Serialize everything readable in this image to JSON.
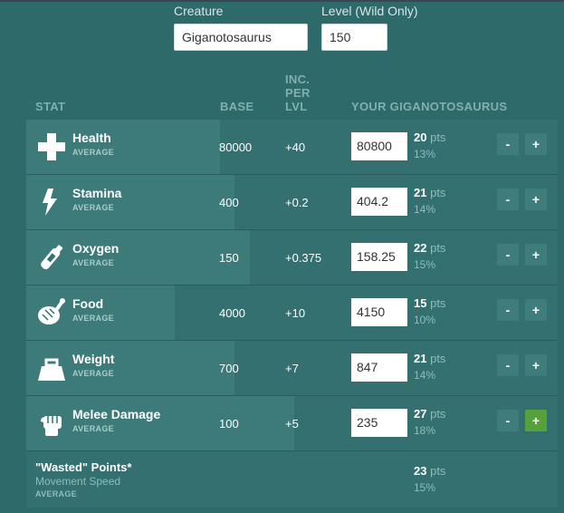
{
  "form": {
    "creature_label": "Creature",
    "creature_value": "Giganotosaurus",
    "level_label": "Level (Wild Only)",
    "level_value": "150"
  },
  "headers": {
    "stat": "STAT",
    "base": "BASE",
    "inc_line1": "INC.",
    "inc_line2": "PER",
    "inc_line3": "LVL",
    "yours": "YOUR GIGANOTOSAURUS"
  },
  "stats": [
    {
      "name": "Health",
      "rating": "AVERAGE",
      "base": "80000",
      "inc": "+40",
      "value": "80800",
      "pts": "20",
      "pts_unit": "pts",
      "pct": "13%",
      "icon": "health-cross-icon",
      "level_fraction": 0.13
    },
    {
      "name": "Stamina",
      "rating": "AVERAGE",
      "base": "400",
      "inc": "+0.2",
      "value": "404.2",
      "pts": "21",
      "pts_unit": "pts",
      "pct": "14%",
      "icon": "lightning-bolt-icon",
      "level_fraction": 0.14
    },
    {
      "name": "Oxygen",
      "rating": "AVERAGE",
      "base": "150",
      "inc": "+0.375",
      "value": "158.25",
      "pts": "22",
      "pts_unit": "pts",
      "pct": "15%",
      "icon": "oxygen-tank-icon",
      "level_fraction": 0.15
    },
    {
      "name": "Food",
      "rating": "AVERAGE",
      "base": "4000",
      "inc": "+10",
      "value": "4150",
      "pts": "15",
      "pts_unit": "pts",
      "pct": "10%",
      "icon": "meat-icon",
      "level_fraction": 0.1
    },
    {
      "name": "Weight",
      "rating": "AVERAGE",
      "base": "700",
      "inc": "+7",
      "value": "847",
      "pts": "21",
      "pts_unit": "pts",
      "pct": "14%",
      "icon": "weight-icon",
      "level_fraction": 0.14
    },
    {
      "name": "Melee Damage",
      "rating": "AVERAGE",
      "base": "100",
      "inc": "+5",
      "value": "235",
      "pts": "27",
      "pts_unit": "pts",
      "pct": "18%",
      "icon": "fist-icon",
      "level_fraction": 0.18
    }
  ],
  "buttons": {
    "minus": "-",
    "plus": "+"
  },
  "wasted": {
    "title": "\"Wasted\" Points*",
    "stat": "Movement Speed",
    "rating": "AVERAGE",
    "pts": "23",
    "pts_unit": "pts",
    "pct": "15%"
  },
  "colors": {
    "background": "#2f6a6a",
    "row": "#347070",
    "row_fill": "#3d7b7a",
    "button": "#3f7d7d",
    "button_active": "#55a13a",
    "header_text": "#7fb0ae"
  }
}
